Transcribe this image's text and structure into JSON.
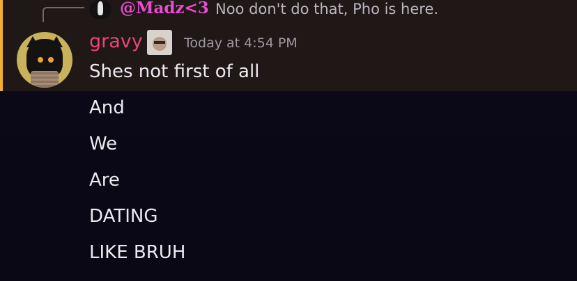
{
  "reply": {
    "mention": "@Madz<3",
    "text": "Noo don't do that, Pho is here."
  },
  "message": {
    "username": "gravy",
    "timestamp": "Today at 4:54 PM",
    "lines": [
      "Shes not first of all",
      "And",
      "We",
      "Are",
      "DATING",
      "LIKE BRUH"
    ]
  },
  "colors": {
    "highlight_bar": "#f0b232",
    "username": "#e9447c",
    "mention": "#e94bd1"
  }
}
